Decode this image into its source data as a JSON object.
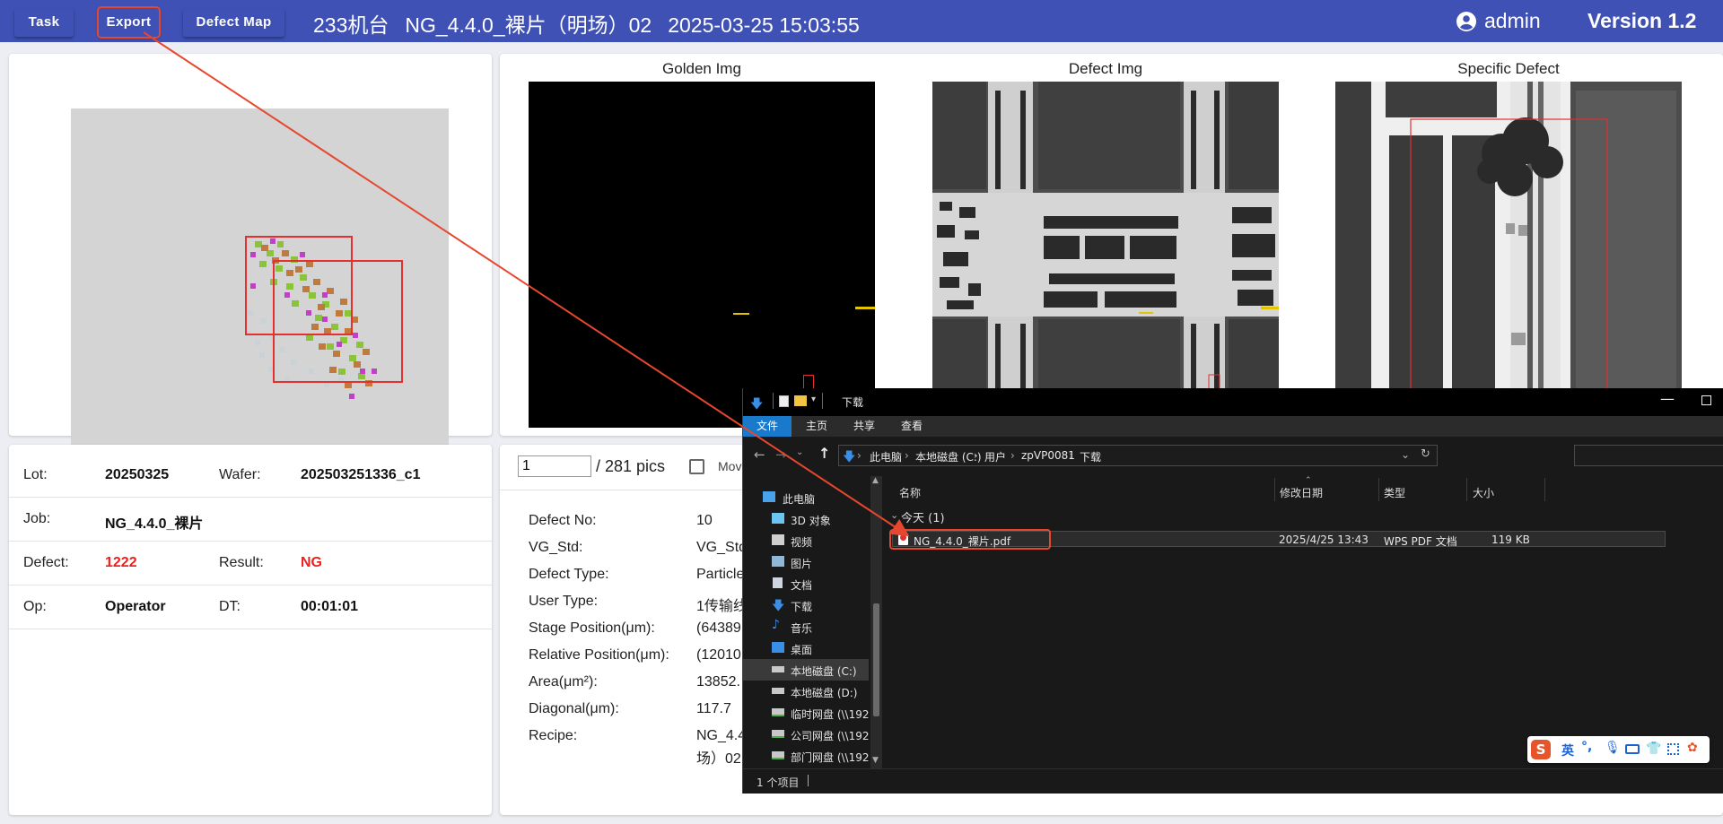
{
  "topbar": {
    "task_label": "Task",
    "export_label": "Export",
    "defect_map_label": "Defect Map",
    "machine": "233机台",
    "recipe": "NG_4.4.0_裸片（明场）02",
    "datetime": "2025-03-25 15:03:55",
    "user": "admin",
    "version": "Version 1.2"
  },
  "images": {
    "golden_title": "Golden Img",
    "defect_title": "Defect Img",
    "specific_title": "Specific Defect"
  },
  "info": {
    "lot_label": "Lot:",
    "lot_value": "20250325",
    "wafer_label": "Wafer:",
    "wafer_value": "202503251336_c1",
    "job_label": "Job:",
    "job_value": "NG_4.4.0_裸片",
    "defect_label": "Defect:",
    "defect_value": "1222",
    "result_label": "Result:",
    "result_value": "NG",
    "op_label": "Op:",
    "op_value": "Operator",
    "dt_label": "DT:",
    "dt_value": "00:01:01"
  },
  "pager": {
    "current": "1",
    "total": "/ 281 pics",
    "movie_label": "Mov"
  },
  "details": [
    {
      "label": "Defect No:",
      "value": "10"
    },
    {
      "label": "VG_Std:",
      "value": "VG_Std"
    },
    {
      "label": "Defect Type:",
      "value": "Particle"
    },
    {
      "label": "User Type:",
      "value": "1传输线"
    },
    {
      "label": "Stage Position(μm):",
      "value": "(64389"
    },
    {
      "label": "Relative Position(μm):",
      "value": "(12010"
    },
    {
      "label": "Area(μm²):",
      "value": "13852."
    },
    {
      "label": "Diagonal(μm):",
      "value": "117.7"
    },
    {
      "label": "Recipe:",
      "value": "NG_4.4"
    },
    {
      "label": "",
      "value": "场）02"
    }
  ],
  "explorer": {
    "title": "下载",
    "ribbon": [
      "文件",
      "主页",
      "共享",
      "查看"
    ],
    "breadcrumb": [
      "此电脑",
      "本地磁盘 (C:)",
      "用户",
      "zpVP0081",
      "下载"
    ],
    "nav": [
      {
        "label": "此电脑",
        "icon": "computer-icon"
      },
      {
        "label": "3D 对象",
        "icon": "cube-icon"
      },
      {
        "label": "视频",
        "icon": "video-icon"
      },
      {
        "label": "图片",
        "icon": "picture-icon"
      },
      {
        "label": "文档",
        "icon": "document-icon"
      },
      {
        "label": "下载",
        "icon": "download-icon"
      },
      {
        "label": "音乐",
        "icon": "music-icon"
      },
      {
        "label": "桌面",
        "icon": "desktop-icon"
      },
      {
        "label": "本地磁盘 (C:)",
        "icon": "drive-icon"
      },
      {
        "label": "本地磁盘 (D:)",
        "icon": "drive-icon"
      },
      {
        "label": "临时网盘 (\\\\192",
        "icon": "network-drive-icon"
      },
      {
        "label": "公司网盘 (\\\\192",
        "icon": "network-drive-icon"
      },
      {
        "label": "部门网盘 (\\\\192",
        "icon": "network-drive-icon"
      }
    ],
    "columns": [
      "名称",
      "修改日期",
      "类型",
      "大小"
    ],
    "group_label": "今天 (1)",
    "file": {
      "name": "NG_4.4.0_裸片.pdf",
      "date": "2025/4/25 13:43",
      "type": "WPS PDF 文档",
      "size": "119 KB"
    },
    "status": "1 个项目"
  },
  "ime": {
    "lang": "英"
  },
  "colors": {
    "appbar": "#3f51b5",
    "highlight": "#e5482e",
    "ng_red": "#ee1f1f",
    "explorer_bg": "#191919",
    "ribbon_active": "#1979ca"
  }
}
